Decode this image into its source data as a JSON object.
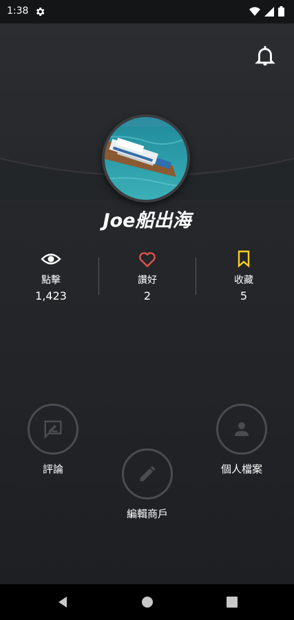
{
  "status_bar": {
    "time": "1:38"
  },
  "profile": {
    "name": "Joe船出海"
  },
  "stats": [
    {
      "label": "點擊",
      "value": "1,423",
      "icon": "eye-icon"
    },
    {
      "label": "讚好",
      "value": "2",
      "icon": "heart-icon"
    },
    {
      "label": "收藏",
      "value": "5",
      "icon": "bookmark-icon"
    }
  ],
  "actions": {
    "reviews": {
      "label": "評論",
      "icon": "comment-edit-icon"
    },
    "profile": {
      "label": "個人檔案",
      "icon": "person-icon"
    },
    "edit_merchant": {
      "label": "編輯商戶",
      "icon": "pencil-icon"
    }
  },
  "colors": {
    "heart": "#e4534a",
    "bookmark": "#f5d020",
    "circle_border": "#4a4c50"
  }
}
